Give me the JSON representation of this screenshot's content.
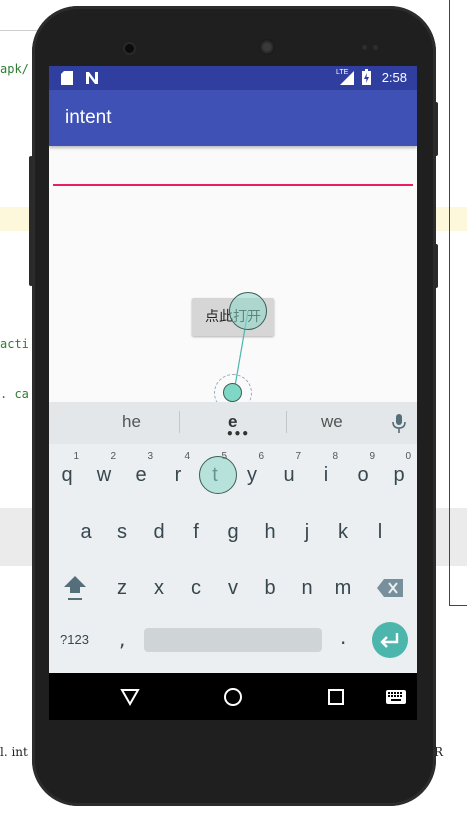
{
  "background": {
    "ide_fragments": [
      "apk/",
      "acti",
      ". ca",
      "l. int",
      "R"
    ]
  },
  "status_bar": {
    "time": "2:58",
    "network": "LTE"
  },
  "app_bar": {
    "title": "intent"
  },
  "content": {
    "text_field_value": "",
    "open_button_label": "点此打开"
  },
  "keyboard": {
    "suggestions": [
      "he",
      "e",
      "we"
    ],
    "row1": [
      {
        "label": "q",
        "hint": "1"
      },
      {
        "label": "w",
        "hint": "2"
      },
      {
        "label": "e",
        "hint": "3"
      },
      {
        "label": "r",
        "hint": "4"
      },
      {
        "label": "t",
        "hint": "5"
      },
      {
        "label": "y",
        "hint": "6"
      },
      {
        "label": "u",
        "hint": "7"
      },
      {
        "label": "i",
        "hint": "8"
      },
      {
        "label": "o",
        "hint": "9"
      },
      {
        "label": "p",
        "hint": "0"
      }
    ],
    "row2": [
      "a",
      "s",
      "d",
      "f",
      "g",
      "h",
      "j",
      "k",
      "l"
    ],
    "row3": [
      "z",
      "x",
      "c",
      "v",
      "b",
      "n",
      "m"
    ],
    "symbols_label": "?123",
    "comma_label": ",",
    "period_label": "."
  },
  "colors": {
    "status_bar": "#303f9f",
    "app_bar": "#3f51b5",
    "accent_line": "#e91e63",
    "enter_key": "#4db6ac"
  }
}
